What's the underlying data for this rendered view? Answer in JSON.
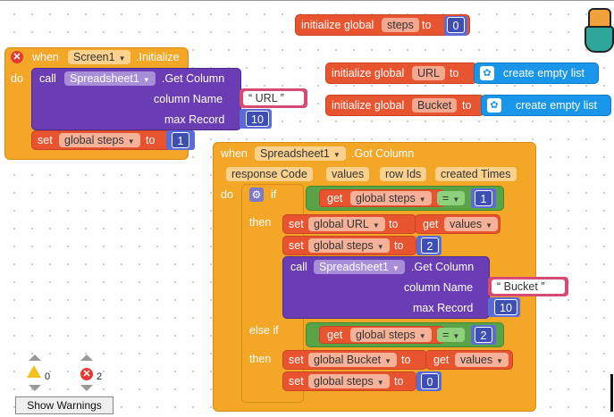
{
  "global_steps_block": {
    "keyword": "initialize global",
    "name": "steps",
    "to": "to",
    "value": "0"
  },
  "global_url_block": {
    "keyword": "initialize global",
    "name": "URL",
    "to": "to",
    "value": "create empty list"
  },
  "global_bucket_block": {
    "keyword": "initialize global",
    "name": "Bucket",
    "to": "to",
    "value": "create empty list"
  },
  "screen_init": {
    "when": "when",
    "component": "Screen1",
    "event": ".Initialize",
    "do": "do",
    "call": "call",
    "call_component": "Spreadsheet1",
    "method": ".Get Column",
    "param1_label": "column Name",
    "param1_value": "URL",
    "param2_label": "max Record",
    "param2_value": "10",
    "set": "set",
    "set_var": "global steps",
    "to": "to",
    "set_value": "1"
  },
  "got_column": {
    "when": "when",
    "component": "Spreadsheet1",
    "event": ".Got Column",
    "params": [
      "response Code",
      "values",
      "row Ids",
      "created Times"
    ],
    "do": "do",
    "if": "if",
    "get": "get",
    "if_var": "global steps",
    "op": "=",
    "if_value": "1",
    "then": "then",
    "set1": "set",
    "set1_var": "global URL",
    "set1_to": "to",
    "set1_get": "get",
    "set1_get_var": "values",
    "set2": "set",
    "set2_var": "global steps",
    "set2_to": "to",
    "set2_value": "2",
    "call": "call",
    "call_component": "Spreadsheet1",
    "method": ".Get Column",
    "param1_label": "column Name",
    "param1_value": "Bucket",
    "param2_label": "max Record",
    "param2_value": "10",
    "elseif": "else if",
    "get2": "get",
    "elseif_var": "global steps",
    "op2": "=",
    "elseif_value": "2",
    "then2": "then",
    "set3": "set",
    "set3_var": "global Bucket",
    "set3_to": "to",
    "set3_get": "get",
    "set3_get_var": "values",
    "set4": "set",
    "set4_var": "global steps",
    "set4_to": "to",
    "set4_value": "0"
  },
  "warnings": {
    "warn_count": "0",
    "error_count": "2",
    "button": "Show Warnings"
  },
  "colors": {
    "event": "#f4a627",
    "procedure": "#6a3db4",
    "variable": "#e8542f",
    "logic": "#5aa448",
    "list": "#1996ea",
    "math": "#5a6ad6",
    "text": "#d64a73"
  }
}
